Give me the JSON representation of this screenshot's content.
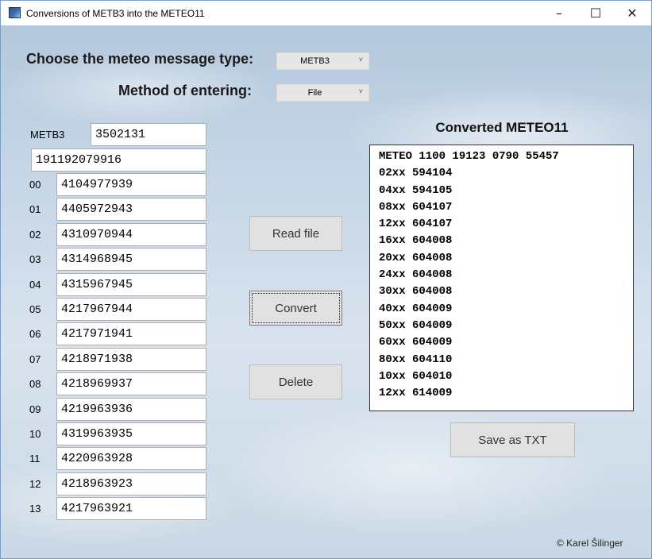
{
  "window": {
    "title": "Conversions of METB3 into the METEO11",
    "min_glyph": "–",
    "max_glyph": "☐",
    "close_glyph": "✕"
  },
  "form": {
    "message_type_label": "Choose the meteo message type:",
    "message_type_value": "METB3",
    "entry_method_label": "Method of entering:",
    "entry_method_value": "File",
    "dropdown_arrow": "˅"
  },
  "metb3": {
    "label": "METB3",
    "code": "3502131",
    "header": "191192079916",
    "rows": [
      {
        "label": "00",
        "value": "4104977939"
      },
      {
        "label": "01",
        "value": "4405972943"
      },
      {
        "label": "02",
        "value": "4310970944"
      },
      {
        "label": "03",
        "value": "4314968945"
      },
      {
        "label": "04",
        "value": "4315967945"
      },
      {
        "label": "05",
        "value": "4217967944"
      },
      {
        "label": "06",
        "value": "4217971941"
      },
      {
        "label": "07",
        "value": "4218971938"
      },
      {
        "label": "08",
        "value": "4218969937"
      },
      {
        "label": "09",
        "value": "4219963936"
      },
      {
        "label": "10",
        "value": "4319963935"
      },
      {
        "label": "11",
        "value": "4220963928"
      },
      {
        "label": "12",
        "value": "4218963923"
      },
      {
        "label": "13",
        "value": "4217963921"
      }
    ]
  },
  "buttons": {
    "read_file": "Read file",
    "convert": "Convert",
    "delete": "Delete",
    "save_txt": "Save as TXT"
  },
  "output": {
    "title": "Converted METEO11",
    "lines": [
      "METEO 1100 19123 0790 55457",
      "02xx 594104",
      "04xx 594105",
      "08xx 604107",
      "12xx 604107",
      "16xx 604008",
      "20xx 604008",
      "24xx 604008",
      "30xx 604008",
      "40xx 604009",
      "50xx 604009",
      "60xx 604009",
      "80xx 604110",
      "10xx 604010",
      "12xx 614009"
    ]
  },
  "credit": "© Karel Šilinger"
}
